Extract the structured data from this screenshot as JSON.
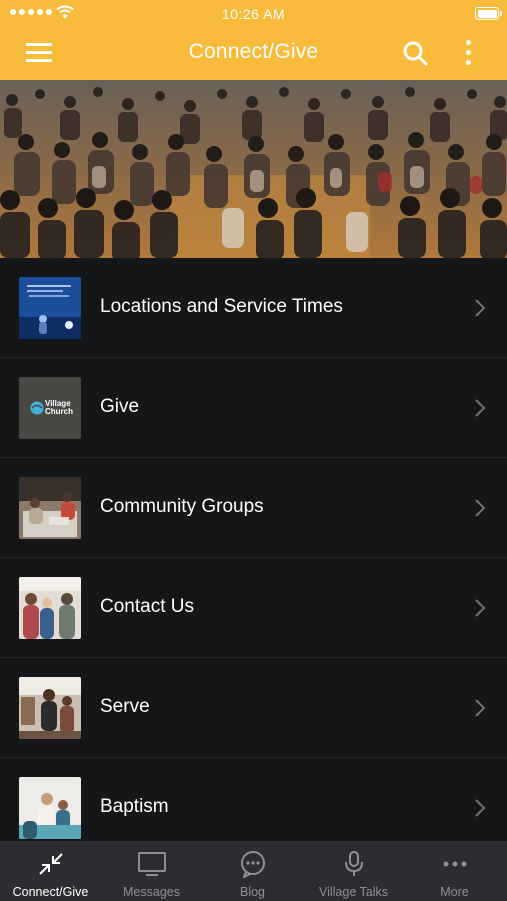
{
  "status_bar": {
    "time": "10:26 AM"
  },
  "header": {
    "title": "Connect/Give"
  },
  "list": {
    "items": [
      {
        "label": "Locations and Service Times"
      },
      {
        "label": "Give",
        "thumb_text": "Village Church"
      },
      {
        "label": "Community Groups"
      },
      {
        "label": "Contact Us"
      },
      {
        "label": "Serve"
      },
      {
        "label": "Baptism"
      }
    ]
  },
  "tabbar": {
    "tabs": [
      {
        "label": "Connect/Give",
        "icon": "collapse-arrows-icon",
        "active": true
      },
      {
        "label": "Messages",
        "icon": "tv-icon",
        "active": false
      },
      {
        "label": "Blog",
        "icon": "chat-bubble-icon",
        "active": false
      },
      {
        "label": "Village Talks",
        "icon": "microphone-icon",
        "active": false
      },
      {
        "label": "More",
        "icon": "more-dots-icon",
        "active": false
      }
    ]
  },
  "colors": {
    "header_bg": "#f9bb3c",
    "list_bg": "#151618",
    "tabbar_bg": "#2b2d30",
    "active_tab": "#ffffff",
    "inactive_tab": "#8e9094"
  }
}
